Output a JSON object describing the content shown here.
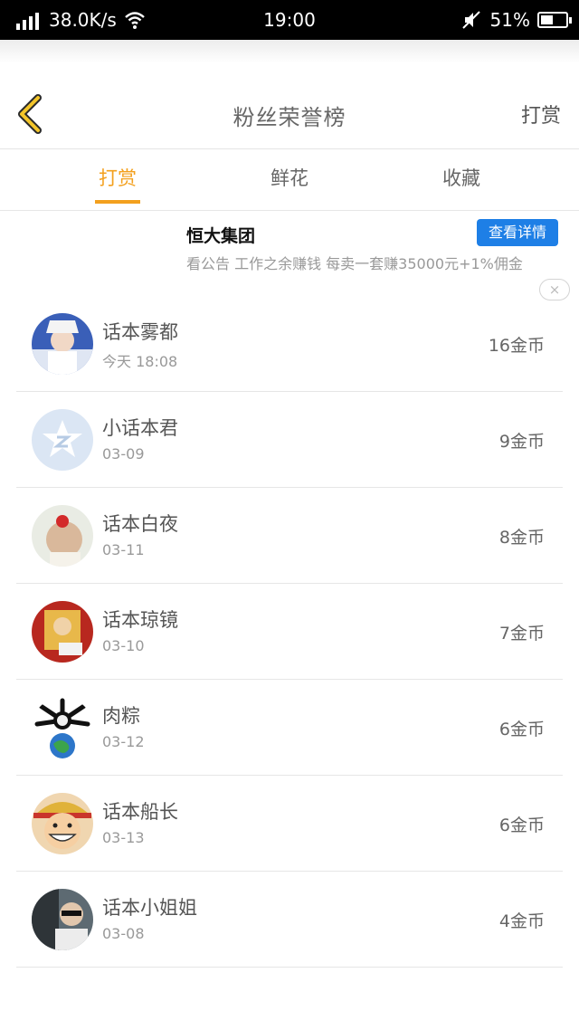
{
  "status_bar": {
    "speed": "38.0K/s",
    "time": "19:00",
    "battery": "51%",
    "battery_level": 0.51
  },
  "header": {
    "title": "粉丝荣誉榜",
    "action_label": "打赏"
  },
  "tabs": [
    {
      "label": "打赏",
      "active": true
    },
    {
      "label": "鲜花",
      "active": false
    },
    {
      "label": "收藏",
      "active": false
    }
  ],
  "ad": {
    "title": "恒大集团",
    "button_label": "查看详情",
    "description": "看公告 工作之余赚钱 每卖一套赚35000元+1%佣金",
    "close_glyph": "×"
  },
  "fans": [
    {
      "name": "话本雾都",
      "date": "今天 18:08",
      "coins": "16金币"
    },
    {
      "name": "小话本君",
      "date": "03-09",
      "coins": "9金币"
    },
    {
      "name": "话本白夜",
      "date": "03-11",
      "coins": "8金币"
    },
    {
      "name": "话本琼镜",
      "date": "03-10",
      "coins": "7金币"
    },
    {
      "name": "肉粽",
      "date": "03-12",
      "coins": "6金币"
    },
    {
      "name": "话本船长",
      "date": "03-13",
      "coins": "6金币"
    },
    {
      "name": "话本小姐姐",
      "date": "03-08",
      "coins": "4金币"
    }
  ],
  "colors": {
    "accent": "#f3a01e",
    "ad_button": "#1e7fe6"
  }
}
